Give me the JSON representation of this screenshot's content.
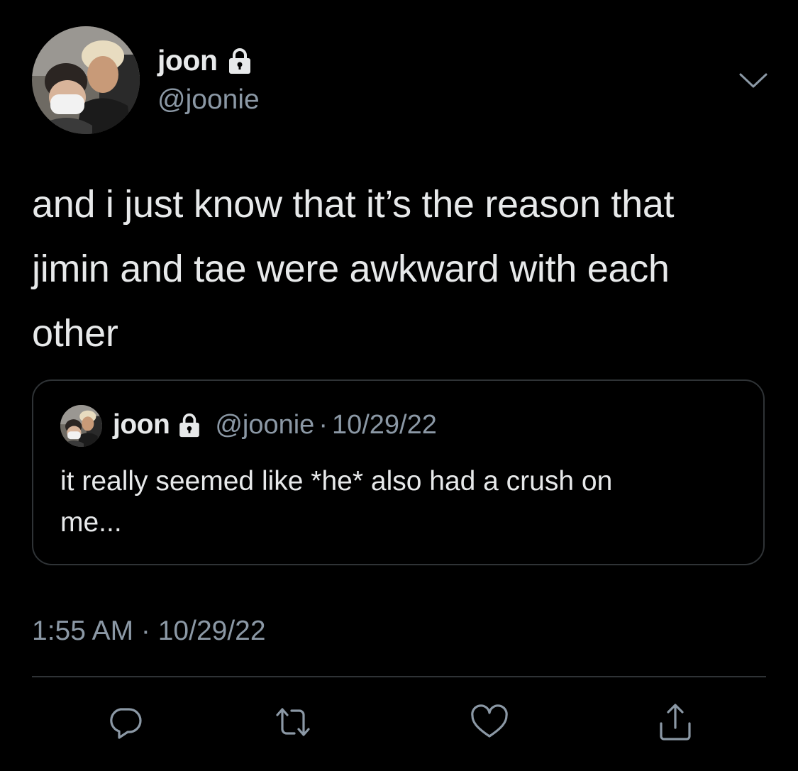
{
  "tweet": {
    "author": {
      "display_name": "joon",
      "handle": "@joonie",
      "protected_icon": "lock-icon"
    },
    "text_lines": [
      "and i just know that it’s the reason that",
      "jimin and tae were awkward with each",
      "other"
    ],
    "timestamp": "1:55 AM · 10/29/22",
    "more_icon": "chevron-down-icon"
  },
  "quoted_tweet": {
    "author": {
      "display_name": "joon",
      "handle": "@joonie",
      "protected_icon": "lock-icon"
    },
    "separator": "·",
    "date": "10/29/22",
    "text_lines": [
      "it really seemed like *he* also had a crush on",
      "me..."
    ]
  },
  "actions": [
    {
      "name": "reply",
      "icon": "reply-icon"
    },
    {
      "name": "retweet",
      "icon": "retweet-icon"
    },
    {
      "name": "like",
      "icon": "heart-icon"
    },
    {
      "name": "share",
      "icon": "share-icon"
    }
  ],
  "colors": {
    "background": "#000000",
    "primary_text": "#e7e9ea",
    "secondary_text": "#8b98a5",
    "border": "#2f3336"
  }
}
